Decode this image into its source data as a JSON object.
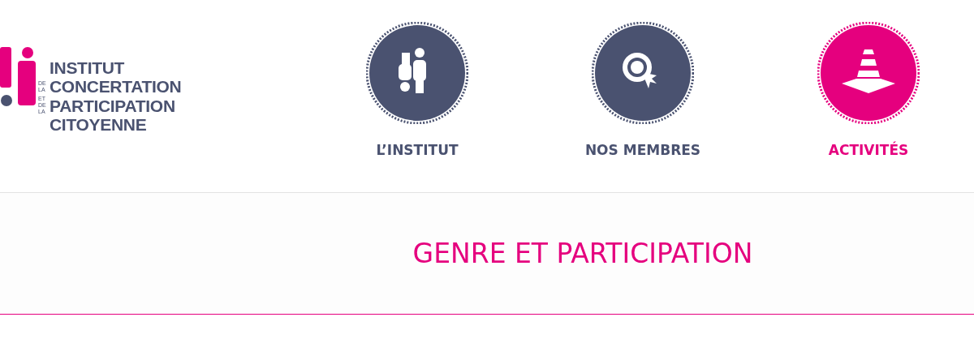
{
  "logo": {
    "lines": [
      {
        "word": "INSTITUT"
      },
      {
        "prefix": "DE LA",
        "word": "CONCERTATION"
      },
      {
        "prefix": "ET DE LA",
        "word": "PARTICIPATION"
      },
      {
        "word": "CITOYENNE"
      }
    ]
  },
  "nav": [
    {
      "label": "L’INSTITUT",
      "kind": "people",
      "selected": false
    },
    {
      "label": "NOS MEMBRES",
      "kind": "rosette",
      "selected": false
    },
    {
      "label": "ACTIVITÉS",
      "kind": "cone",
      "selected": true
    }
  ],
  "page_title": "GENRE ET PARTICIPATION"
}
